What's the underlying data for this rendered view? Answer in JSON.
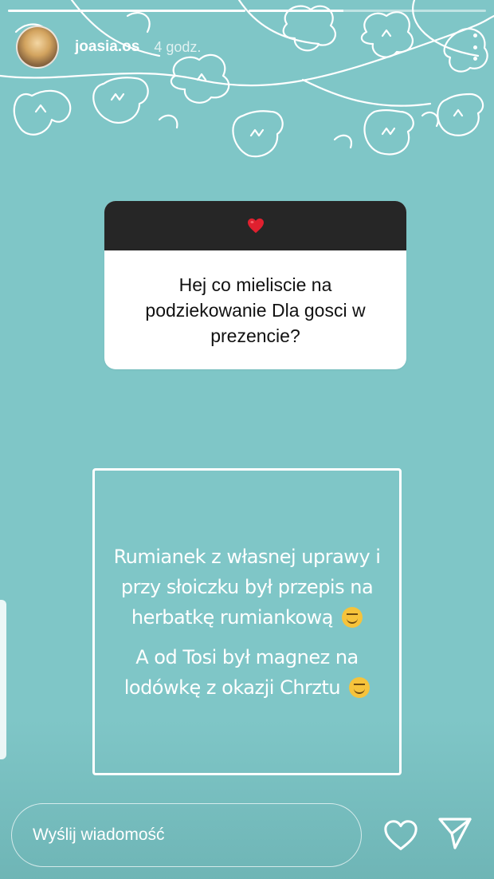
{
  "story": {
    "progress_segments": [
      1,
      0.4
    ],
    "user": {
      "username": "joasia.os",
      "time": "4 godz."
    }
  },
  "question": {
    "header_emoji": "❤️",
    "text": "Hej co mieliscie na podziekowanie Dla gosci w prezencie?"
  },
  "answer": {
    "paragraphs": [
      "Rumianek z własnej uprawy i przy słoiczku był przepis na herbatkę rumiankową",
      "A od Tosi był magnez na lodówkę z okazji Chrztu"
    ],
    "emoji": "smiling-face-emoji"
  },
  "footer": {
    "reply_placeholder": "Wyślij wiadomość",
    "like_icon": "heart-icon",
    "send_icon": "send-icon"
  },
  "colors": {
    "background": "#7fc6c7",
    "question_header": "#262626",
    "heart": "#e0202f"
  }
}
